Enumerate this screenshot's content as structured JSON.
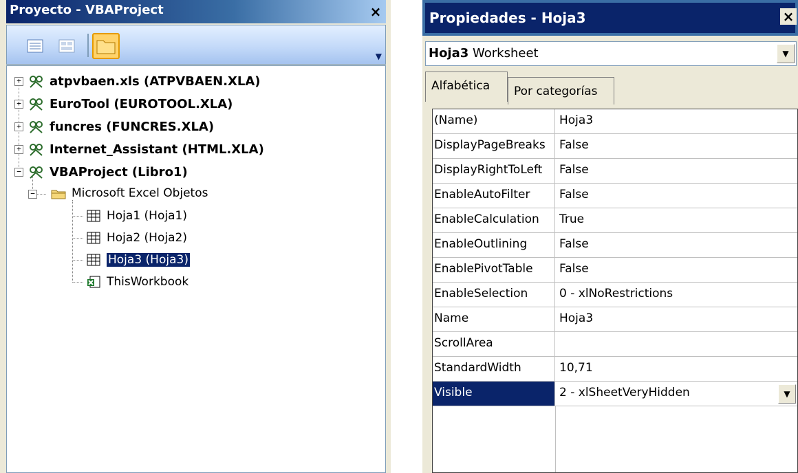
{
  "project_explorer": {
    "title": "Proyecto - VBAProject",
    "close_glyph": "×",
    "toolbar": {
      "view_code_icon": "view-code-icon",
      "view_object_icon": "view-object-icon",
      "toggle_folders_icon": "folder-icon"
    },
    "tree": [
      {
        "label": "atpvbaen.xls (ATPVBAEN.XLA)",
        "expander": "+",
        "icon": "vba-project-icon"
      },
      {
        "label": "EuroTool (EUROTOOL.XLA)",
        "expander": "+",
        "icon": "vba-project-icon"
      },
      {
        "label": "funcres (FUNCRES.XLA)",
        "expander": "+",
        "icon": "vba-project-icon"
      },
      {
        "label": "Internet_Assistant (HTML.XLA)",
        "expander": "+",
        "icon": "vba-project-icon"
      },
      {
        "label": "VBAProject (Libro1)",
        "expander": "−",
        "icon": "vba-project-icon"
      }
    ],
    "folder": {
      "label": "Microsoft Excel Objetos",
      "expander": "−",
      "icon": "folder-icon"
    },
    "objects": [
      {
        "label": "Hoja1 (Hoja1)",
        "icon": "worksheet-icon",
        "selected": false
      },
      {
        "label": "Hoja2 (Hoja2)",
        "icon": "worksheet-icon",
        "selected": false
      },
      {
        "label": "Hoja3 (Hoja3)",
        "icon": "worksheet-icon",
        "selected": true
      },
      {
        "label": "ThisWorkbook",
        "icon": "workbook-icon",
        "selected": false
      }
    ]
  },
  "properties": {
    "title": "Propiedades - Hoja3",
    "close_glyph": "×",
    "object_name": "Hoja3",
    "object_type": "Worksheet",
    "tabs": [
      "Alfabética",
      "Por categorías"
    ],
    "active_tab": "Alfabética",
    "rows": [
      {
        "name": "(Name)",
        "value": "Hoja3"
      },
      {
        "name": "DisplayPageBreaks",
        "value": "False"
      },
      {
        "name": "DisplayRightToLeft",
        "value": "False"
      },
      {
        "name": "EnableAutoFilter",
        "value": "False"
      },
      {
        "name": "EnableCalculation",
        "value": "True"
      },
      {
        "name": "EnableOutlining",
        "value": "False"
      },
      {
        "name": "EnablePivotTable",
        "value": "False"
      },
      {
        "name": "EnableSelection",
        "value": "0 - xlNoRestrictions"
      },
      {
        "name": "Name",
        "value": "Hoja3"
      },
      {
        "name": "ScrollArea",
        "value": ""
      },
      {
        "name": "StandardWidth",
        "value": "10,71"
      },
      {
        "name": "Visible",
        "value": "2 - xlSheetVeryHidden",
        "active": true
      }
    ],
    "dropdown_glyph": "▼"
  },
  "colors": {
    "title_bar": "#0a246a",
    "selection": "#0a246a",
    "panel_bg": "#ece9d8"
  }
}
